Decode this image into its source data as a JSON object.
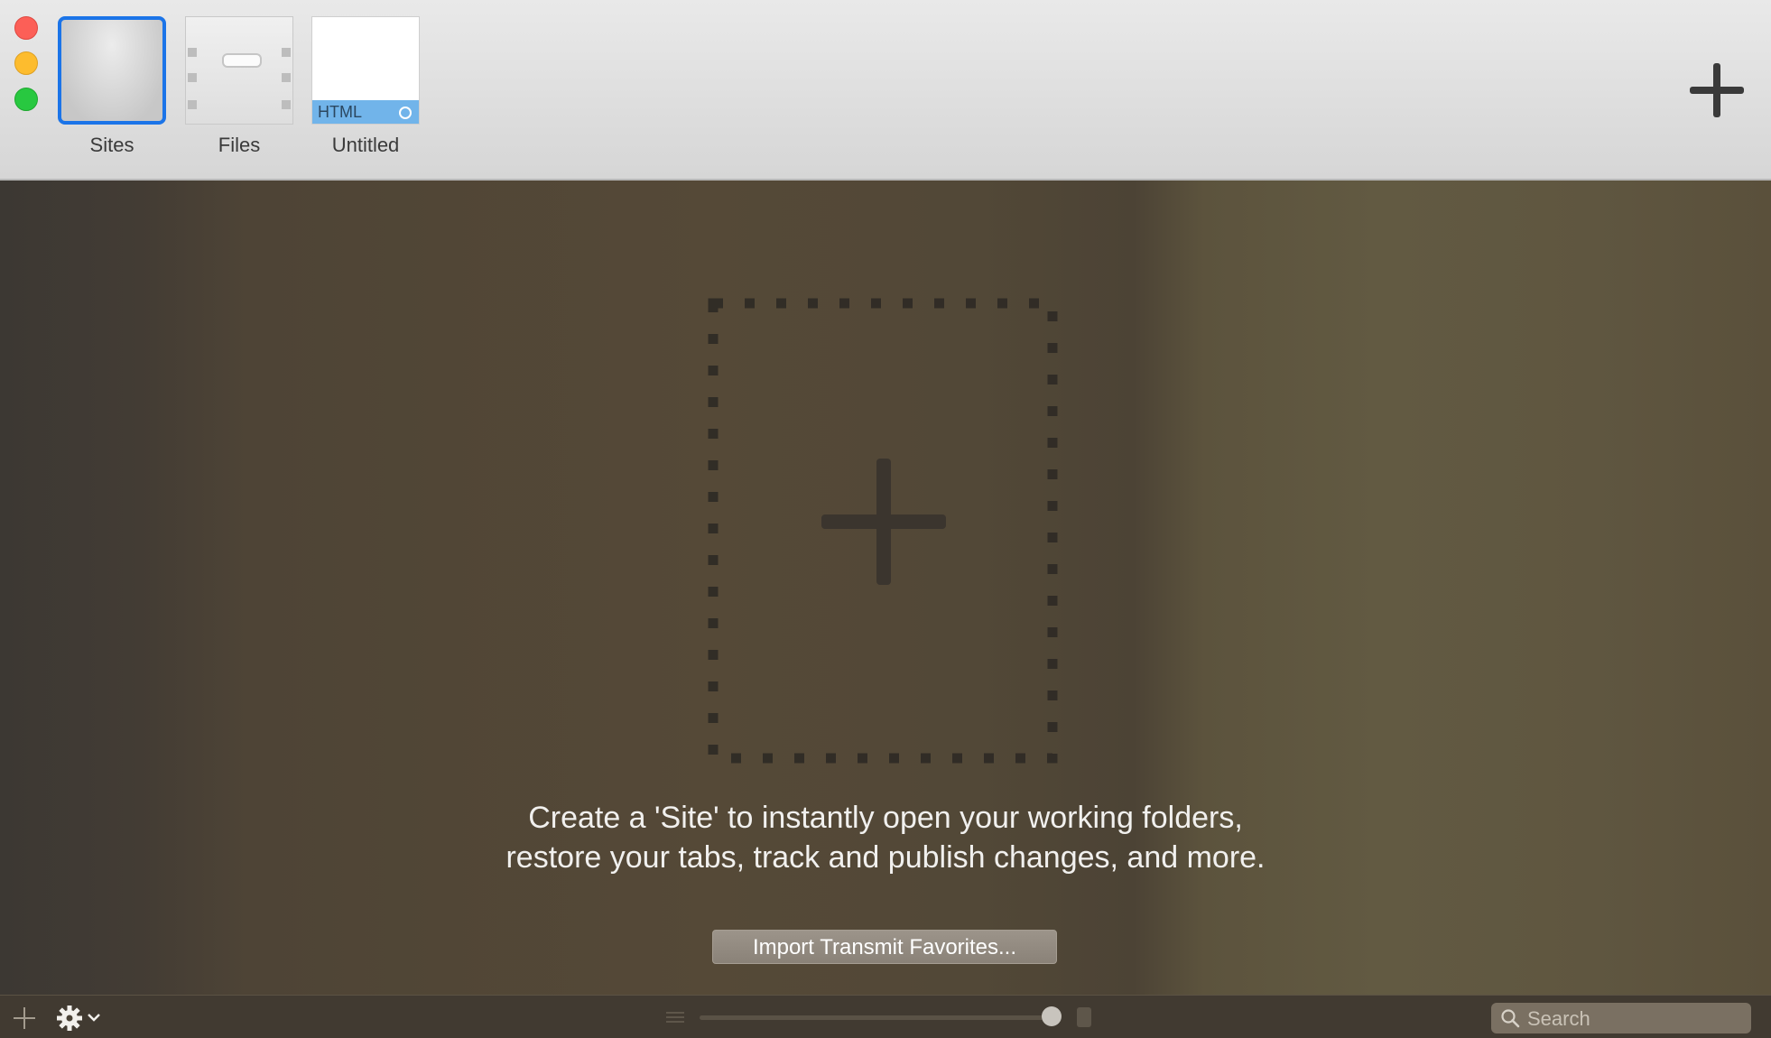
{
  "window": {
    "traffic_lights": [
      "close",
      "minimize",
      "zoom"
    ]
  },
  "toolbar": {
    "tabs": [
      {
        "label": "Sites",
        "icon": "sites-thumbnail-icon",
        "selected": true
      },
      {
        "label": "Files",
        "icon": "files-box-icon",
        "selected": false
      },
      {
        "label": "Untitled",
        "icon": "html-document-icon",
        "badge": "HTML",
        "selected": false
      }
    ],
    "add_icon": "plus-icon"
  },
  "main": {
    "dropzone_icon": "plus-icon",
    "message_line1": "Create a 'Site' to instantly open your working folders,",
    "message_line2": "restore your tabs, track and publish changes, and more.",
    "import_button": "Import Transmit Favorites..."
  },
  "bottombar": {
    "icons": [
      "plus-icon",
      "gear-icon",
      "chevron-down-icon",
      "list-view-icon",
      "grid-view-icon",
      "search-icon"
    ],
    "search_placeholder": "Search"
  },
  "colors": {
    "selection_border": "#1b74e8",
    "html_badge": "#71b4ea",
    "close": "#fc5f57",
    "minimize": "#fdbc2e",
    "zoom": "#28c840"
  }
}
